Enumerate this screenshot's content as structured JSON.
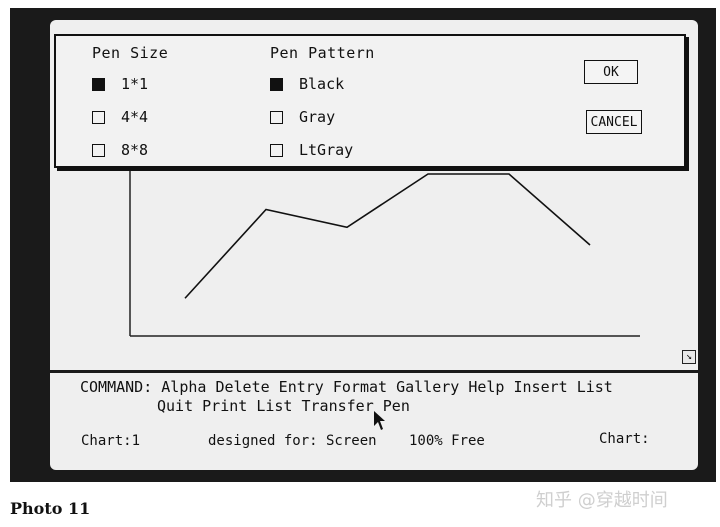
{
  "dialog": {
    "pen_size": {
      "title": "Pen Size",
      "options": [
        {
          "label": "1*1",
          "checked": true
        },
        {
          "label": "4*4",
          "checked": false
        },
        {
          "label": "8*8",
          "checked": false
        }
      ]
    },
    "pen_pattern": {
      "title": "Pen Pattern",
      "options": [
        {
          "label": "Black",
          "checked": true
        },
        {
          "label": "Gray",
          "checked": false
        },
        {
          "label": "LtGray",
          "checked": false
        }
      ]
    },
    "ok_label": "OK",
    "cancel_label": "CANCEL"
  },
  "command_bar": {
    "line1": "COMMAND: Alpha Delete Entry Format Gallery Help Insert List",
    "line2": "Quit Print List Transfer Pen"
  },
  "status_bar": {
    "chart": "Chart:1",
    "designed_for": "designed for: Screen",
    "free": "100% Free",
    "chart_right": "Chart:"
  },
  "caption": "Photo 11",
  "watermark": "知乎 @穿越时间",
  "chart_data": {
    "type": "line",
    "x": [
      1,
      2,
      3,
      4,
      5,
      6
    ],
    "series": [
      {
        "values": [
          1,
          6,
          5,
          8,
          8,
          4
        ]
      }
    ],
    "ylim": [
      0,
      8
    ],
    "grid": false
  },
  "colors": {
    "ink": "#111111",
    "screen": "#efefef",
    "frame": "#1a1a1a"
  }
}
